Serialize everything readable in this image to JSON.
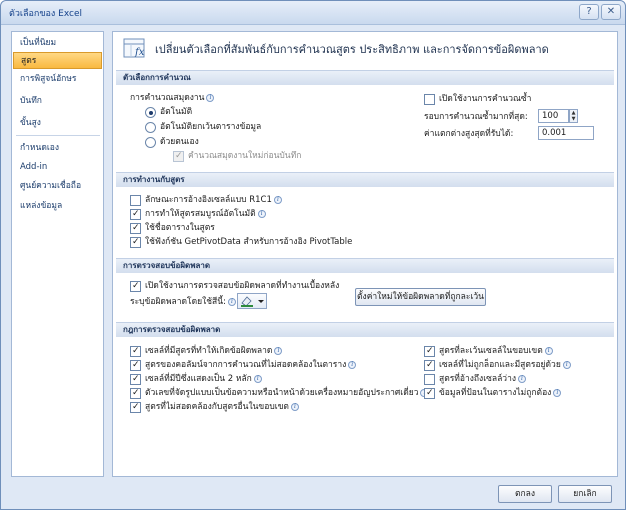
{
  "window": {
    "title": "ตัวเลือกของ Excel",
    "help": "?",
    "close": "✕"
  },
  "nav": {
    "items": [
      {
        "label": "เป็นที่นิยม"
      },
      {
        "label": "สูตร"
      },
      {
        "label": "การพิสูจน์อักษร"
      },
      {
        "label": "บันทึก"
      },
      {
        "label": "ขั้นสูง"
      },
      {
        "label": "กำหนดเอง"
      },
      {
        "label": "Add-in"
      },
      {
        "label": "ศูนย์ความเชื่อถือ"
      },
      {
        "label": "แหล่งข้อมูล"
      }
    ],
    "active_index": 1
  },
  "header": {
    "title": "เปลี่ยนตัวเลือกที่สัมพันธ์กับการคำนวณสูตร ประสิทธิภาพ และการจัดการข้อผิดพลาด"
  },
  "calc": {
    "section": "ตัวเลือกการคำนวณ",
    "workbook_calc_label": "การคำนวณสมุดงาน",
    "auto": "อัตโนมัติ",
    "auto_except_tables": "อัตโนมัติยกเว้นตารางข้อมูล",
    "manual": "ด้วยตนเอง",
    "recalc_before_save": "คำนวณสมุดงานใหม่ก่อนบันทึก",
    "enable_iterative": "เปิดใช้งานการคำนวณซ้ำ",
    "max_iterations_label": "รอบการคำนวณซ้ำมากที่สุด:",
    "max_iterations_value": "100",
    "max_change_label": "ค่าแตกต่างสูงสุดที่รับได้:",
    "max_change_value": "0.001"
  },
  "working": {
    "section": "การทำงานกับสูตร",
    "items": [
      {
        "label": "ลักษณะการอ้างอิงเซลล์แบบ R1C1",
        "checked": false
      },
      {
        "label": "การทำให้สูตรสมบูรณ์อัตโนมัติ",
        "checked": true
      },
      {
        "label": "ใช้ชื่อตารางในสูตร",
        "checked": true
      },
      {
        "label": "ใช้ฟังก์ชัน GetPivotData สำหรับการอ้างอิง PivotTable",
        "checked": true
      }
    ]
  },
  "error_check": {
    "section": "การตรวจสอบข้อผิดพลาด",
    "enable_bg": "เปิดใช้งานการตรวจสอบข้อผิดพลาดที่ทำงานเบื้องหลัง",
    "color_label": "ระบุข้อผิดพลาดโดยใช้สีนี้:",
    "reset_button": "ตั้งค่าใหม่ให้ข้อผิดพลาดที่ถูกละเว้น"
  },
  "rules": {
    "section": "กฎการตรวจสอบข้อผิดพลาด",
    "left": [
      {
        "label": "เซลล์ที่มีสูตรที่ทำให้เกิดข้อผิดพลาด",
        "checked": true
      },
      {
        "label": "สูตรของคอลัมน์จากการคำนวณที่ไม่สอดคล้องในตาราง",
        "checked": true
      },
      {
        "label": "เซลล์ที่มีปีซึ่งแสดงเป็น 2 หลัก",
        "checked": true
      },
      {
        "label": "ตัวเลขที่จัดรูปแบบเป็นข้อความหรือนำหน้าด้วยเครื่องหมายอัญประกาศเดี่ยว",
        "checked": true
      },
      {
        "label": "สูตรที่ไม่สอดคล้องกับสูตรอื่นในขอบเขต",
        "checked": true
      }
    ],
    "right": [
      {
        "label": "สูตรที่ละเว้นเซลล์ในขอบเขต",
        "checked": true
      },
      {
        "label": "เซลล์ที่ไม่ถูกล็อกและมีสูตรอยู่ด้วย",
        "checked": true
      },
      {
        "label": "สูตรที่อ้างถึงเซลล์ว่าง",
        "checked": false
      },
      {
        "label": "ข้อมูลที่ป้อนในตารางไม่ถูกต้อง",
        "checked": true
      }
    ]
  },
  "footer": {
    "ok": "ตกลง",
    "cancel": "ยกเลิก"
  }
}
